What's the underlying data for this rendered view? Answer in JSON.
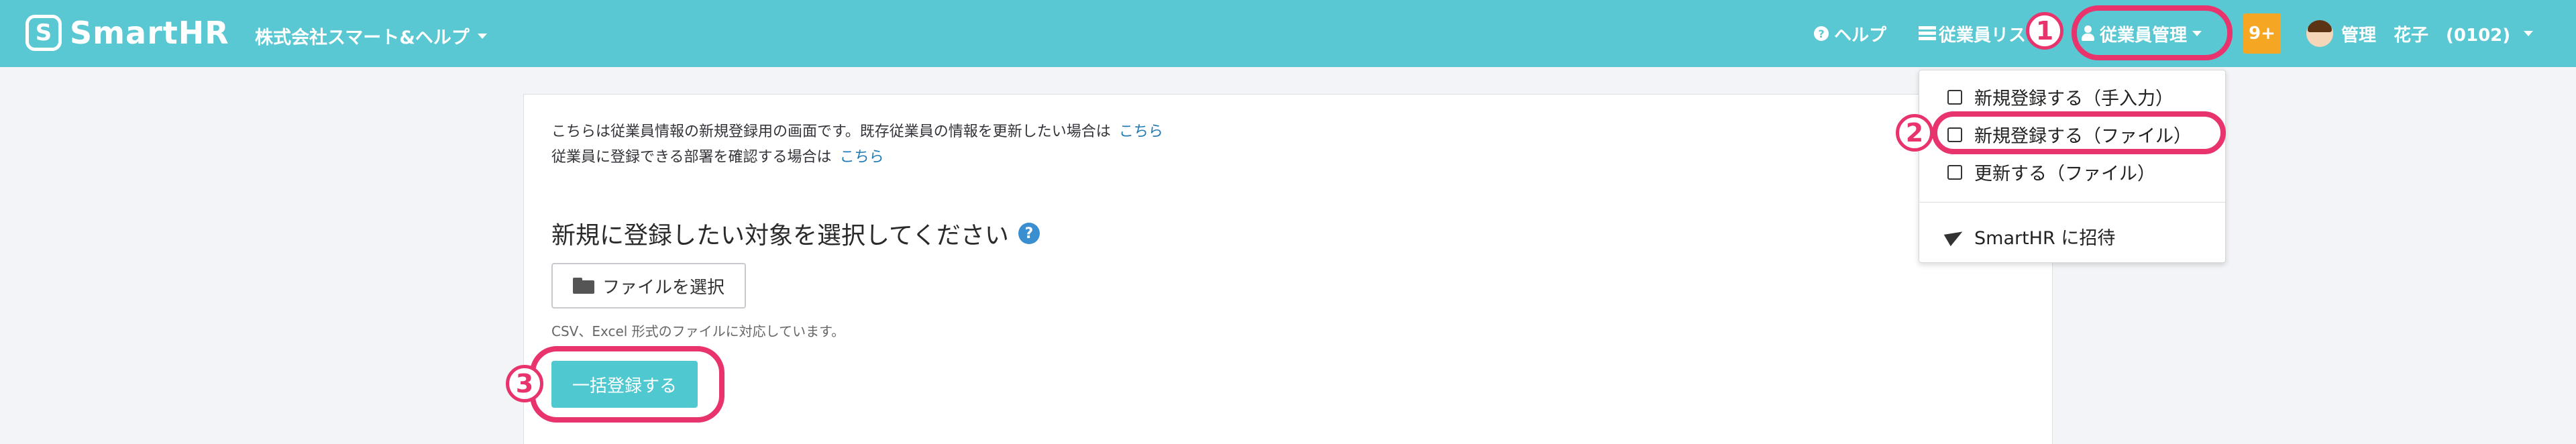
{
  "header": {
    "logo_text": "SmartHR",
    "logo_mark": "S",
    "company": "株式会社スマート&ヘルプ",
    "help_label": "ヘルプ",
    "employee_list_label": "従業員リスト",
    "employee_manage_label": "従業員管理",
    "notification_count": "9+",
    "user_name": "管理　花子　(0102)"
  },
  "main": {
    "info_line1": "こちらは従業員情報の新規登録用の画面です。既存従業員の情報を更新したい場合は",
    "info_line1_link": "こちら",
    "info_line2": "従業員に登録できる部署を確認する場合は",
    "info_line2_link": "こちら",
    "section_title": "新規に登録したい対象を選択してください",
    "file_button": "ファイルを選択",
    "hint": "CSV、Excel 形式のファイルに対応しています。",
    "bulk_button": "一括登録する"
  },
  "dropdown": {
    "items": [
      {
        "label": "新規登録する（手入力）",
        "icon": "edit-icon"
      },
      {
        "label": "新規登録する（ファイル）",
        "icon": "file-add-icon"
      },
      {
        "label": "更新する（ファイル）",
        "icon": "file-refresh-icon"
      },
      {
        "label": "SmartHR に招待",
        "icon": "paper-plane-icon"
      }
    ]
  },
  "annotations": {
    "step1": "1",
    "step2": "2",
    "step3": "3",
    "color": "#e8336d"
  },
  "colors": {
    "header_bg": "#5ac8d2",
    "badge": "#f5a623",
    "primary_button": "#50c8d0",
    "link": "#1f7ab4"
  }
}
